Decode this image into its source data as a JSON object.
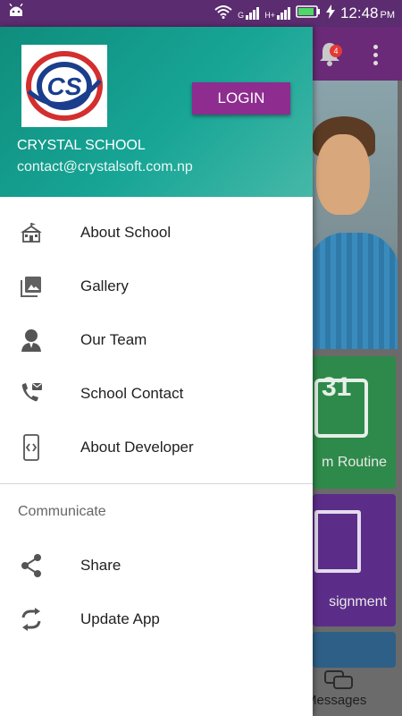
{
  "status_bar": {
    "time": "12:48",
    "ampm": "PM",
    "sim1": "G",
    "sim2": "H+",
    "icons": [
      "android-icon",
      "wifi-icon",
      "signal-icon",
      "signal2-icon",
      "battery-icon",
      "charging-icon"
    ]
  },
  "background_app": {
    "notification_count": "4",
    "tiles": [
      {
        "label": "m Routine",
        "color": "#2e8a4a",
        "calendar_day": "31"
      },
      {
        "label": "signment",
        "color": "#5b2d88"
      }
    ],
    "bottom_nav_label": "Messages"
  },
  "drawer": {
    "logo_text": "CS",
    "login_label": "LOGIN",
    "school_name": "CRYSTAL SCHOOL",
    "email": "contact@crystalsoft.com.np",
    "menu_items": [
      {
        "label": "About School",
        "icon": "school-building-icon"
      },
      {
        "label": "Gallery",
        "icon": "gallery-icon"
      },
      {
        "label": "Our Team",
        "icon": "team-member-icon"
      },
      {
        "label": "School Contact",
        "icon": "phone-contact-icon"
      },
      {
        "label": "About Developer",
        "icon": "developer-phone-icon"
      }
    ],
    "section_title": "Communicate",
    "communicate_items": [
      {
        "label": "Share",
        "icon": "share-icon"
      },
      {
        "label": "Update App",
        "icon": "sync-icon"
      }
    ]
  },
  "colors": {
    "header_teal": "#17a596",
    "login_purple": "#8e2c8f",
    "status_purple": "#5b2c6f"
  }
}
